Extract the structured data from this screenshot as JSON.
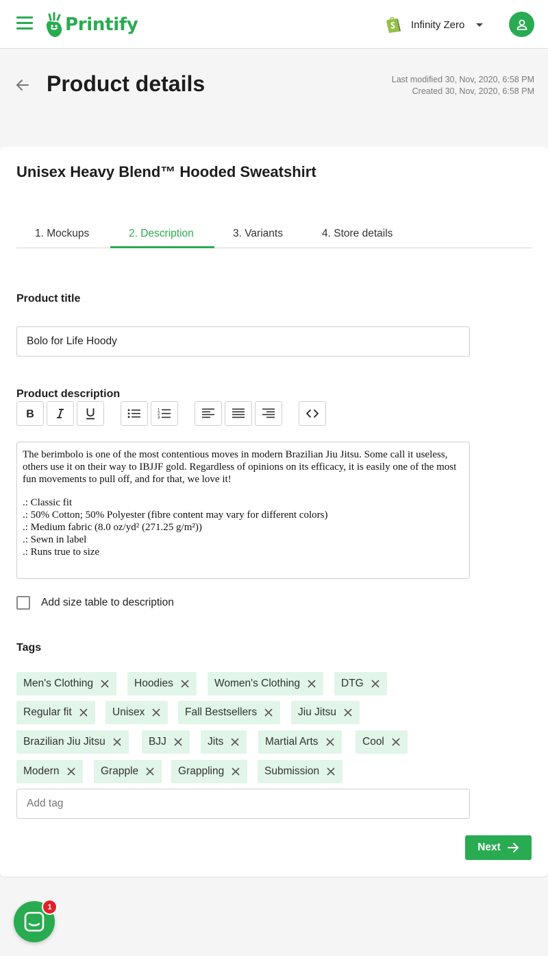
{
  "brand": {
    "name": "Printify",
    "accent": "#29ab51"
  },
  "topbar": {
    "store_name": "Infinity Zero"
  },
  "header": {
    "title": "Product details",
    "last_modified": "Last modified 30, Nov, 2020, 6:58 PM",
    "created": "Created 30, Nov, 2020, 6:58 PM"
  },
  "product": {
    "name": "Unisex Heavy Blend™ Hooded Sweatshirt"
  },
  "tabs": [
    {
      "label": "1. Mockups"
    },
    {
      "label": "2. Description",
      "active": true
    },
    {
      "label": "3. Variants"
    },
    {
      "label": "4. Store details"
    }
  ],
  "form": {
    "title_label": "Product title",
    "title_value": "Bolo for Life Hoody",
    "description_label": "Product description",
    "toolbar_icons": [
      "bold-icon",
      "italic-icon",
      "underline-icon",
      "bullet-list-icon",
      "numbered-list-icon",
      "align-left-icon",
      "align-justify-icon",
      "align-right-icon",
      "code-icon"
    ],
    "description_paragraph": "The berimbolo is one of the most contentious moves in modern Brazilian Jiu Jitsu. Some call it useless, others use it on their way to IBJJF gold. Regardless of opinions on its efficacy, it is easily one of the most fun movements to pull off, and for that, we love it!",
    "description_bullets": [
      ".: Classic fit",
      ".: 50% Cotton; 50% Polyester (fibre content may vary for different colors)",
      ".: Medium fabric (8.0 oz/yd² (271.25 g/m²))",
      ".: Sewn in label",
      ".: Runs true to size"
    ],
    "size_table_label": "Add size table to description",
    "size_table_checked": false,
    "tags_label": "Tags",
    "tags": [
      "Men's Clothing",
      "Hoodies",
      "Women's Clothing",
      "DTG",
      "Regular fit",
      "Unisex",
      "Fall Bestsellers",
      "Jiu Jitsu",
      "Brazilian Jiu Jitsu",
      "BJJ",
      "Jits",
      "Martial Arts",
      "Cool",
      "Modern",
      "Grapple",
      "Grappling",
      "Submission"
    ],
    "add_tag_placeholder": "Add tag",
    "next_label": "Next"
  },
  "chat": {
    "badge_count": "1"
  }
}
